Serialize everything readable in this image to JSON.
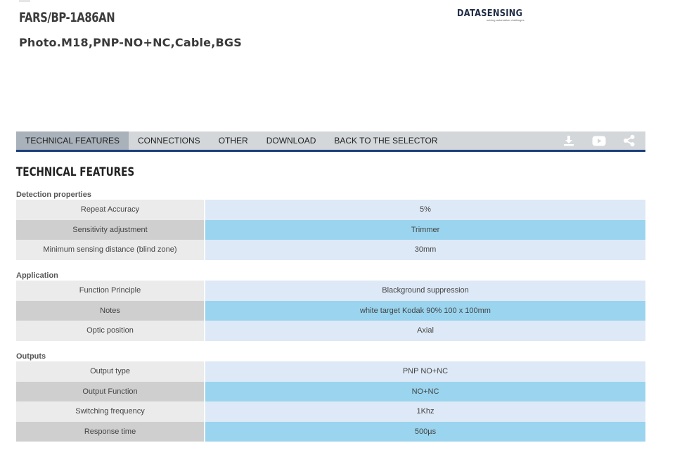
{
  "header": {
    "product_code": "FARS/BP-1A86AN",
    "product_description": "Photo.M18,PNP-NO+NC,Cable,BGS",
    "logo_text": "DATASENSING",
    "logo_tagline": "solving automation challenges"
  },
  "tabs": [
    {
      "label": "TECHNICAL FEATURES",
      "active": true
    },
    {
      "label": "CONNECTIONS",
      "active": false
    },
    {
      "label": "OTHER",
      "active": false
    },
    {
      "label": "DOWNLOAD",
      "active": false
    },
    {
      "label": "BACK TO THE SELECTOR",
      "active": false
    }
  ],
  "tab_icons": [
    "download-icon",
    "youtube-icon",
    "share-icon"
  ],
  "section_title": "TECHNICAL FEATURES",
  "groups": [
    {
      "title": "Detection properties",
      "rows": [
        {
          "label": "Repeat Accuracy",
          "value": "5%"
        },
        {
          "label": "Sensitivity adjustment",
          "value": "Trimmer"
        },
        {
          "label": "Minimum sensing distance (blind zone)",
          "value": "30mm"
        }
      ]
    },
    {
      "title": "Application",
      "rows": [
        {
          "label": "Function Principle",
          "value": "Blackground suppression"
        },
        {
          "label": "Notes",
          "value": "white target Kodak 90% 100 x 100mm"
        },
        {
          "label": "Optic position",
          "value": "Axial"
        }
      ]
    },
    {
      "title": "Outputs",
      "rows": [
        {
          "label": "Output type",
          "value": "PNP NO+NC"
        },
        {
          "label": "Output Function",
          "value": "NO+NC"
        },
        {
          "label": "Switching frequency",
          "value": "1Khz"
        },
        {
          "label": "Response time",
          "value": "500µs"
        }
      ]
    }
  ],
  "colors": {
    "tab_bar": "#d3d7da",
    "tab_active": "#a9b1ba",
    "tab_underline": "#1c3f7c",
    "row_light_label": "#ebebeb",
    "row_light_value": "#dde9f6",
    "row_dark_label": "#cfcfcf",
    "row_dark_value": "#9ad4ee"
  }
}
